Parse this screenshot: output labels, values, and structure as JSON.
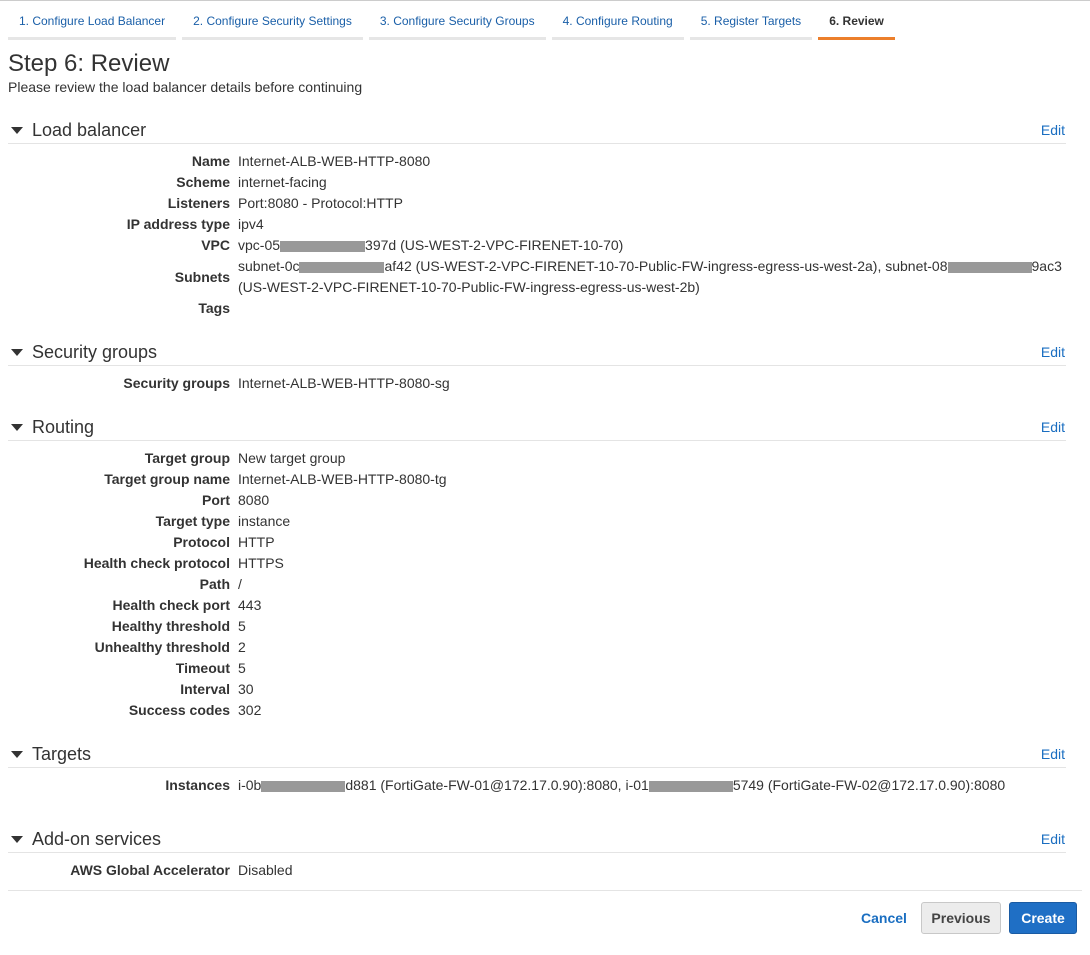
{
  "tabs": [
    "1. Configure Load Balancer",
    "2. Configure Security Settings",
    "3. Configure Security Groups",
    "4. Configure Routing",
    "5. Register Targets",
    "6. Review"
  ],
  "title": "Step 6: Review",
  "subtitle": "Please review the load balancer details before continuing",
  "edit_label": "Edit",
  "load_balancer": {
    "title": "Load balancer",
    "name_l": "Name",
    "name": "Internet-ALB-WEB-HTTP-8080",
    "scheme_l": "Scheme",
    "scheme": "internet-facing",
    "listeners_l": "Listeners",
    "listeners": "Port:8080 - Protocol:HTTP",
    "ip_l": "IP address type",
    "ip": "ipv4",
    "vpc_l": "VPC",
    "vpc_a": "vpc-05",
    "vpc_b": "397d (US-WEST-2-VPC-FIRENET-10-70)",
    "subnets_l": "Subnets",
    "sub1_a": "subnet-0c",
    "sub1_b": "af42 (US-WEST-2-VPC-FIRENET-10-70-Public-FW-ingress-egress-us-west-2a), subnet-08",
    "sub2_b": "9ac3",
    "sub_line2": "(US-WEST-2-VPC-FIRENET-10-70-Public-FW-ingress-egress-us-west-2b)",
    "tags_l": "Tags"
  },
  "security_groups": {
    "title": "Security groups",
    "label": "Security groups",
    "value": "Internet-ALB-WEB-HTTP-8080-sg"
  },
  "routing": {
    "title": "Routing",
    "rows": [
      [
        "Target group",
        "New target group"
      ],
      [
        "Target group name",
        "Internet-ALB-WEB-HTTP-8080-tg"
      ],
      [
        "Port",
        "8080"
      ],
      [
        "Target type",
        "instance"
      ],
      [
        "Protocol",
        "HTTP"
      ],
      [
        "Health check protocol",
        "HTTPS"
      ],
      [
        "Path",
        "/"
      ],
      [
        "Health check port",
        "443"
      ],
      [
        "Healthy threshold",
        "5"
      ],
      [
        "Unhealthy threshold",
        "2"
      ],
      [
        "Timeout",
        "5"
      ],
      [
        "Interval",
        "30"
      ],
      [
        "Success codes",
        "302"
      ]
    ]
  },
  "targets": {
    "title": "Targets",
    "label": "Instances",
    "i1_a": "i-0b",
    "i1_b": "d881 (FortiGate-FW-01@172.17.0.90):8080, i-01",
    "i2_b": "5749 (FortiGate-FW-02@172.17.0.90):8080"
  },
  "addons": {
    "title": "Add-on services",
    "label": "AWS Global Accelerator",
    "value": "Disabled"
  },
  "buttons": {
    "cancel": "Cancel",
    "previous": "Previous",
    "create": "Create"
  }
}
